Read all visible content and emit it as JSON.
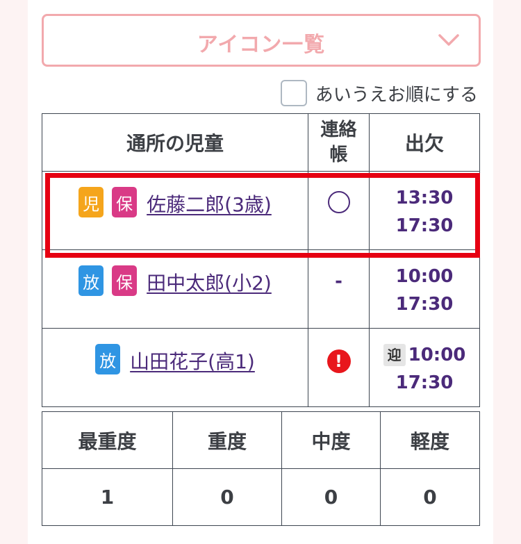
{
  "dropdown": {
    "label": "アイコン一覧",
    "icon": "chevron-down-icon"
  },
  "sort_option": {
    "label": "あいうえお順にする",
    "checked": false
  },
  "roster": {
    "headers": {
      "child": "通所の児童",
      "contact_line1": "連絡",
      "contact_line2": "帳",
      "attendance": "出欠"
    },
    "rows": [
      {
        "badges": [
          {
            "text": "児",
            "color": "#f5a51c"
          },
          {
            "text": "保",
            "color": "#d93a86"
          }
        ],
        "name": "佐藤二郎(3歳)",
        "contact": "○",
        "pickup": "",
        "time_in": "13:30",
        "time_out": "17:30",
        "highlighted": true
      },
      {
        "badges": [
          {
            "text": "放",
            "color": "#2f95e3"
          },
          {
            "text": "保",
            "color": "#d93a86"
          }
        ],
        "name": "田中太郎(小2)",
        "contact": "-",
        "pickup": "",
        "time_in": "10:00",
        "time_out": "17:30",
        "highlighted": false
      },
      {
        "badges": [
          {
            "text": "放",
            "color": "#2f95e3"
          }
        ],
        "name": "山田花子(高1)",
        "contact": "!",
        "pickup": "迎",
        "time_in": "10:00",
        "time_out": "17:30",
        "highlighted": false
      }
    ]
  },
  "summary": {
    "headers": [
      "最重度",
      "重度",
      "中度",
      "軽度"
    ],
    "values": [
      "1",
      "0",
      "0",
      "0"
    ]
  },
  "colors": {
    "accent_pink": "#f2a9ad",
    "link_purple": "#4b2a7a",
    "highlight_red": "#e60012",
    "alert_red": "#e8161c"
  }
}
